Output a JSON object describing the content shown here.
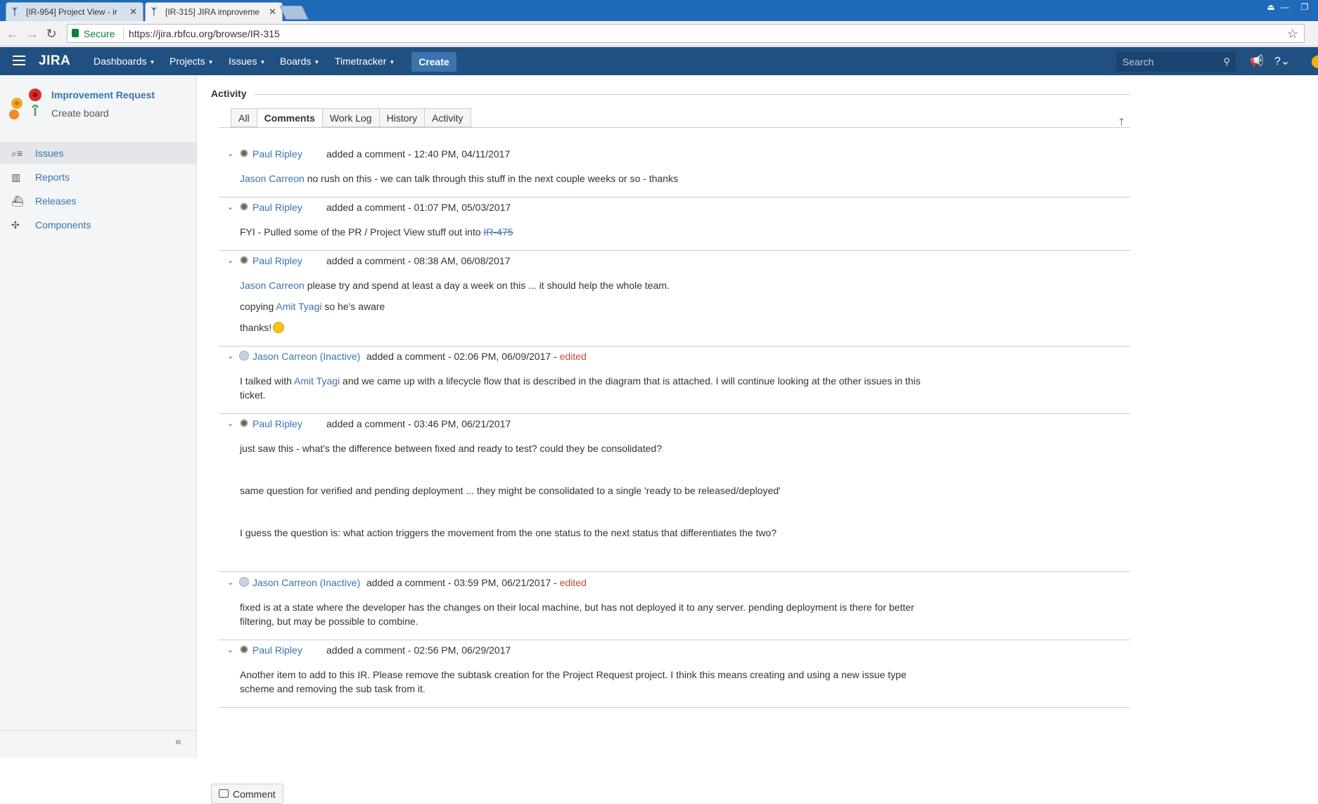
{
  "browser": {
    "tabs": [
      {
        "title": "[IR-954] Project View - ir",
        "active": false
      },
      {
        "title": "[IR-315] JIRA improveme",
        "active": true
      }
    ],
    "secure_label": "Secure",
    "url": "https://jira.rbfcu.org/browse/IR-315"
  },
  "header": {
    "logo": "JIRA",
    "nav": [
      "Dashboards",
      "Projects",
      "Issues",
      "Boards",
      "Timetracker"
    ],
    "create_label": "Create",
    "search_placeholder": "Search"
  },
  "sidebar": {
    "project_name": "Improvement Request",
    "project_sub": "Create board",
    "items": [
      {
        "label": "Issues",
        "icon": "issues-icon",
        "selected": true
      },
      {
        "label": "Reports",
        "icon": "reports-icon",
        "selected": false
      },
      {
        "label": "Releases",
        "icon": "releases-icon",
        "selected": false
      },
      {
        "label": "Components",
        "icon": "components-icon",
        "selected": false
      }
    ],
    "collapse_label": "«"
  },
  "activity": {
    "heading": "Activity",
    "tabs": [
      "All",
      "Comments",
      "Work Log",
      "History",
      "Activity"
    ],
    "active_tab": "Comments"
  },
  "comments": [
    {
      "author": "Paul Ripley",
      "action": "added a comment - 12:40 PM, 04/11/2017",
      "edited": "",
      "lines": [
        {
          "mention": "Jason Carreon",
          "text": " no rush on this - we can talk through this stuff in the next couple weeks or so - thanks"
        }
      ]
    },
    {
      "author": "Paul Ripley",
      "action": "added a comment - 01:07 PM, 05/03/2017",
      "edited": "",
      "lines": [
        {
          "text": "FYI - Pulled some of the PR / Project View stuff out into ",
          "link": "IR-475"
        }
      ]
    },
    {
      "author": "Paul Ripley",
      "action": "added a comment - 08:38 AM, 06/08/2017",
      "edited": "",
      "lines": [
        {
          "mention": "Jason Carreon",
          "text": " please try and spend at least a day a week on this ... it should help the whole team."
        },
        {
          "prefix": "copying ",
          "mention": "Amit Tyagi",
          "text": " so he's aware"
        },
        {
          "text": "thanks!"
        }
      ]
    },
    {
      "author": "Jason Carreon (Inactive)",
      "action": "added a comment - 02:06 PM, 06/09/2017 - ",
      "edited": "edited",
      "lines": [
        {
          "prefix": "I talked with ",
          "mention": "Amit Tyagi",
          "text": " and we came up with a lifecycle flow that is described in the diagram that is attached. I will continue looking at the other issues in this ticket."
        }
      ]
    },
    {
      "author": "Paul Ripley",
      "action": "added a comment - 03:46 PM, 06/21/2017",
      "edited": "",
      "lines": [
        {
          "text": "just saw this - what's the difference between fixed and ready to test?  could they be consolidated?"
        },
        {
          "text": "same question for verified and pending deployment ... they might be consolidated to a single 'ready to be released/deployed'"
        },
        {
          "text": "I guess the question is: what action triggers the movement from the one status to the next status that differentiates the two?"
        }
      ]
    },
    {
      "author": "Jason Carreon (Inactive)",
      "action": "added a comment - 03:59 PM, 06/21/2017 - ",
      "edited": "edited",
      "lines": [
        {
          "text": "fixed is at a state where the developer has the changes on their local machine, but has not deployed it to any server. pending deployment is there for better filtering, but may be possible to combine."
        }
      ]
    },
    {
      "author": "Paul Ripley",
      "action": "added a comment - 02:56 PM, 06/29/2017",
      "edited": "",
      "lines": [
        {
          "text": "Another item to add to this IR.  Please remove the subtask creation for the Project Request project.  I think this means creating and using a new issue type scheme and removing the sub task from it."
        }
      ]
    }
  ],
  "comment_button": "Comment",
  "colors": {
    "header": "#205081",
    "link": "#3b73af",
    "create": "#3b73af",
    "edited": "#d04437"
  }
}
